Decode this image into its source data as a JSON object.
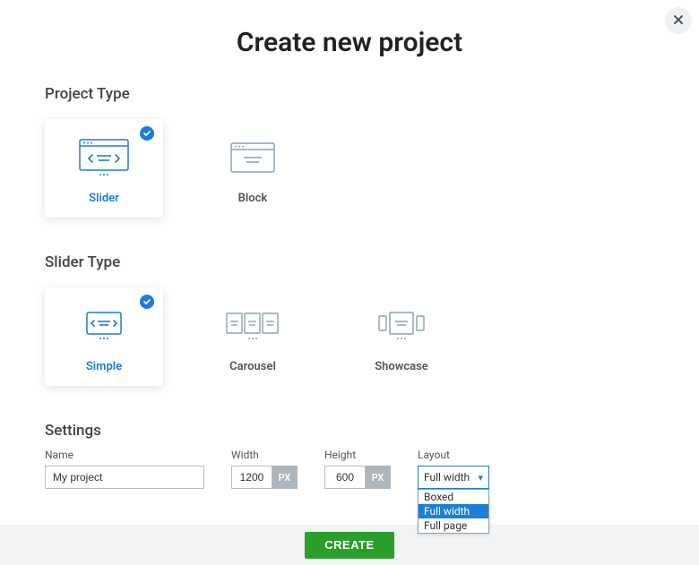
{
  "title": "Create new project",
  "sections": {
    "projectType": {
      "header": "Project Type",
      "options": {
        "slider": "Slider",
        "block": "Block"
      }
    },
    "sliderType": {
      "header": "Slider Type",
      "options": {
        "simple": "Simple",
        "carousel": "Carousel",
        "showcase": "Showcase"
      }
    },
    "settings": {
      "header": "Settings",
      "name": {
        "label": "Name",
        "value": "My project"
      },
      "width": {
        "label": "Width",
        "value": "1200",
        "unit": "PX"
      },
      "height": {
        "label": "Height",
        "value": "600",
        "unit": "PX"
      },
      "layout": {
        "label": "Layout",
        "selected": "Full width",
        "options": [
          "Boxed",
          "Full width",
          "Full page"
        ]
      }
    }
  },
  "footer": {
    "create": "CREATE"
  }
}
